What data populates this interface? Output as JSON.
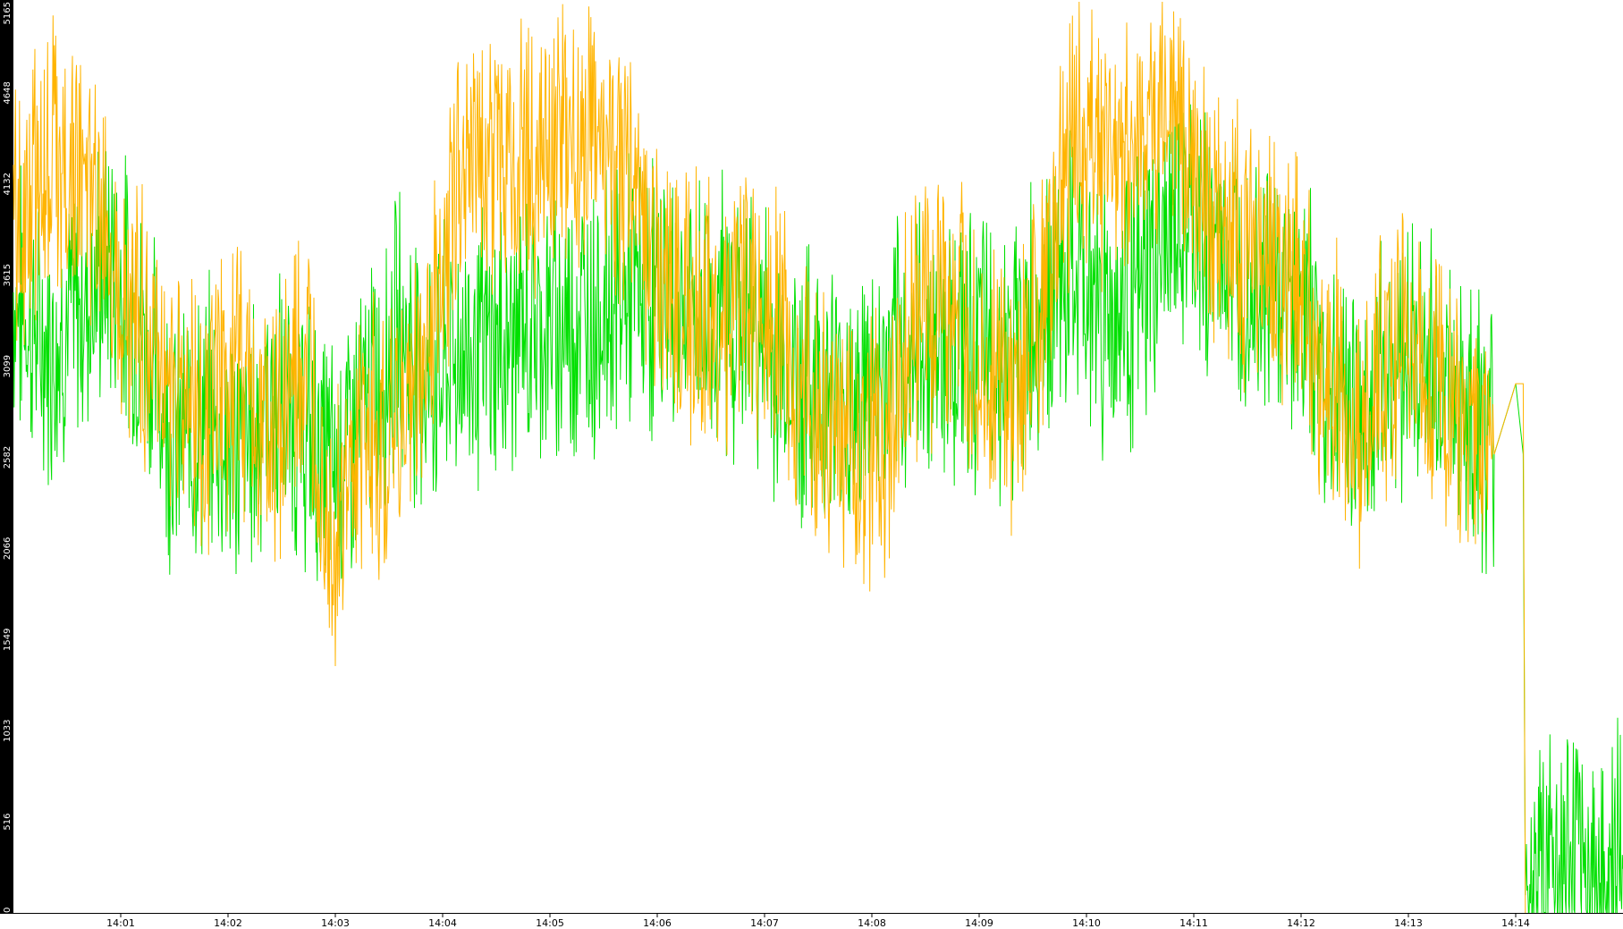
{
  "chart_data": {
    "type": "line",
    "title": "",
    "xlabel": "",
    "ylabel": "",
    "ylim": [
      0,
      5165
    ],
    "y_ticks": [
      "0",
      "516",
      "1033",
      "1549",
      "2066",
      "2582",
      "3099",
      "3615",
      "4132",
      "4648",
      "5165"
    ],
    "x_ticks": [
      "14:01",
      "14:02",
      "14:03",
      "14:04",
      "14:05",
      "14:06",
      "14:07",
      "14:08",
      "14:09",
      "14:10",
      "14:11",
      "14:12",
      "14:13",
      "14:14"
    ],
    "xlim_minutes": [
      0.0,
      15.0
    ],
    "grid": false,
    "legend": "none",
    "colors": {
      "series_green": "#00e000",
      "series_orange": "#ffb400",
      "y_axis_band": "#000000",
      "x_axis_line": "#000000"
    },
    "series": [
      {
        "color": "#00e000",
        "points": [
          [
            0.0,
            3500
          ],
          [
            0.3,
            3200
          ],
          [
            0.6,
            3400
          ],
          [
            0.9,
            3700
          ],
          [
            1.2,
            3300
          ],
          [
            1.5,
            2700
          ],
          [
            1.8,
            2800
          ],
          [
            2.1,
            2600
          ],
          [
            2.4,
            2900
          ],
          [
            2.7,
            2700
          ],
          [
            3.0,
            2500
          ],
          [
            3.3,
            2900
          ],
          [
            3.6,
            3300
          ],
          [
            3.9,
            3000
          ],
          [
            4.2,
            3200
          ],
          [
            4.5,
            3200
          ],
          [
            4.8,
            3300
          ],
          [
            5.1,
            3350
          ],
          [
            5.4,
            3400
          ],
          [
            5.7,
            3500
          ],
          [
            6.0,
            3500
          ],
          [
            6.3,
            3400
          ],
          [
            6.6,
            3400
          ],
          [
            6.9,
            3350
          ],
          [
            7.2,
            3000
          ],
          [
            7.5,
            3000
          ],
          [
            7.8,
            2900
          ],
          [
            8.1,
            3000
          ],
          [
            8.4,
            3200
          ],
          [
            8.7,
            3250
          ],
          [
            9.0,
            3200
          ],
          [
            9.3,
            3100
          ],
          [
            9.6,
            3500
          ],
          [
            9.9,
            3600
          ],
          [
            10.2,
            3400
          ],
          [
            10.5,
            3500
          ],
          [
            10.8,
            3900
          ],
          [
            11.1,
            3800
          ],
          [
            11.4,
            3700
          ],
          [
            11.7,
            3600
          ],
          [
            12.0,
            3400
          ],
          [
            12.3,
            3000
          ],
          [
            12.6,
            2800
          ],
          [
            12.9,
            3200
          ],
          [
            13.2,
            3100
          ],
          [
            13.5,
            2900
          ],
          [
            13.8,
            2600
          ],
          [
            14.0,
            3000
          ],
          [
            14.07,
            2600
          ],
          [
            14.09,
            100
          ],
          [
            14.1,
            250
          ],
          [
            15.0,
            250
          ]
        ]
      },
      {
        "color": "#ffb400",
        "points": [
          [
            0.0,
            3900
          ],
          [
            0.3,
            4300
          ],
          [
            0.6,
            4200
          ],
          [
            0.9,
            3800
          ],
          [
            1.2,
            3300
          ],
          [
            1.5,
            3000
          ],
          [
            1.8,
            2800
          ],
          [
            2.1,
            3100
          ],
          [
            2.4,
            2700
          ],
          [
            2.7,
            3100
          ],
          [
            3.0,
            2100
          ],
          [
            3.3,
            2700
          ],
          [
            3.6,
            2700
          ],
          [
            3.9,
            3300
          ],
          [
            4.2,
            4400
          ],
          [
            4.5,
            4300
          ],
          [
            4.8,
            4250
          ],
          [
            5.1,
            4400
          ],
          [
            5.4,
            4300
          ],
          [
            5.7,
            4200
          ],
          [
            6.0,
            3700
          ],
          [
            6.3,
            3400
          ],
          [
            6.6,
            3300
          ],
          [
            6.9,
            3500
          ],
          [
            7.2,
            3200
          ],
          [
            7.5,
            2700
          ],
          [
            7.8,
            2700
          ],
          [
            8.1,
            2600
          ],
          [
            8.4,
            3400
          ],
          [
            8.7,
            3500
          ],
          [
            9.0,
            3100
          ],
          [
            9.3,
            2800
          ],
          [
            9.6,
            3500
          ],
          [
            9.9,
            4400
          ],
          [
            10.2,
            4300
          ],
          [
            10.5,
            4350
          ],
          [
            10.8,
            4600
          ],
          [
            11.1,
            4000
          ],
          [
            11.4,
            3800
          ],
          [
            11.7,
            3700
          ],
          [
            12.0,
            3500
          ],
          [
            12.3,
            3000
          ],
          [
            12.6,
            2800
          ],
          [
            12.9,
            3300
          ],
          [
            13.2,
            3100
          ],
          [
            13.5,
            2800
          ],
          [
            13.8,
            2600
          ],
          [
            14.0,
            3000
          ],
          [
            14.07,
            3000
          ],
          [
            14.09,
            0
          ]
        ]
      }
    ]
  }
}
